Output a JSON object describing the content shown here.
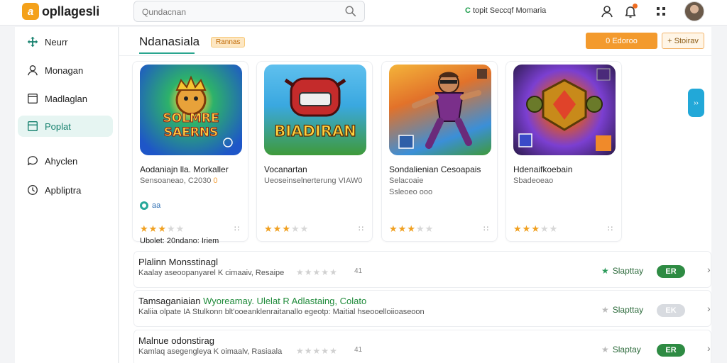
{
  "app": {
    "logo_text": "opllagesli",
    "logo_mark": "a"
  },
  "search": {
    "placeholder": "Qundacnan"
  },
  "topbar": {
    "status_text": "topit Seccqf Momaria",
    "status_dot": "C",
    "notification_dot_color": "#ef6c20"
  },
  "sidebar": {
    "items": [
      {
        "label": "Neurr",
        "icon": "move-icon",
        "active": false
      },
      {
        "label": "Monagan",
        "icon": "user-icon",
        "active": false
      },
      {
        "label": "Madlaglan",
        "icon": "window-icon",
        "active": false
      },
      {
        "label": "Poplat",
        "icon": "grid-square-icon",
        "active": true
      },
      {
        "label": "Ahyclen",
        "icon": "chat-icon",
        "active": false
      },
      {
        "label": "Apbliptra",
        "icon": "clock-icon",
        "active": false
      }
    ]
  },
  "main": {
    "title": "Ndanasiala",
    "badge": "Rannas",
    "primary_button": "0 Edoroo",
    "secondary_button": "+ Stoirav",
    "scroll_next": "››"
  },
  "cards": [
    {
      "art_title": "SOLMRE SAERNS",
      "art_colors": [
        "#1f9a55",
        "#1e56c8"
      ],
      "name": "Aodaniajn lla. Morkaller",
      "sub": "Sensoaneao, C2030",
      "sub_badge": "0",
      "chip": "aa",
      "rating": 3,
      "more": "∷",
      "foot": "Ubolet: 20ndano: Iriem"
    },
    {
      "art_title": "BIADIRAN",
      "art_colors": [
        "#4fb1e8",
        "#3a9a3c"
      ],
      "name": "Vocanartan",
      "sub": "Ueoseinselnerterung VIAW0",
      "rating": 3,
      "more": "∷"
    },
    {
      "art_title": "",
      "art_colors": [
        "#f2a52a",
        "#2e7fcf"
      ],
      "name": "Sondalienian Cesoapais",
      "sub": "Selacoaie",
      "sub2": "Ssleoeo ooo",
      "rating": 3,
      "more": "∷"
    },
    {
      "art_title": "",
      "art_colors": [
        "#7b3fd1",
        "#e0551f"
      ],
      "name": "Hdenaifkoebain",
      "sub": "Sbadeoeao",
      "rating": 3,
      "more": "∷"
    }
  ],
  "rows": [
    {
      "title": "Plalinn Monsstinagl",
      "title_highlight": "",
      "desc": "Kaalay aseoopanyarel K cimaaiv, Resaipe",
      "stars": 5,
      "count": "41",
      "status": "Slapttay",
      "pill": "ER",
      "pill_on": true
    },
    {
      "title": "Tamsaganiaian ",
      "title_highlight": "Wyoreamay. Ulelat R Adlastaing, Colato",
      "desc": "Kaliia olpate IA Stulkonn blt'ooeanklenraitanallo egeotp: Maitial hseooelloiioaseoon",
      "stars": 0,
      "count": "",
      "status": "Slapttay",
      "pill": "EK",
      "pill_on": false
    },
    {
      "title": "Malnue odonstirag",
      "title_highlight": "",
      "desc": "Kamlaq asegengleya K oimaalv, Rasiaala",
      "stars": 5,
      "count": "41",
      "status": "Slaptay",
      "pill": "ER",
      "pill_on": true
    }
  ]
}
